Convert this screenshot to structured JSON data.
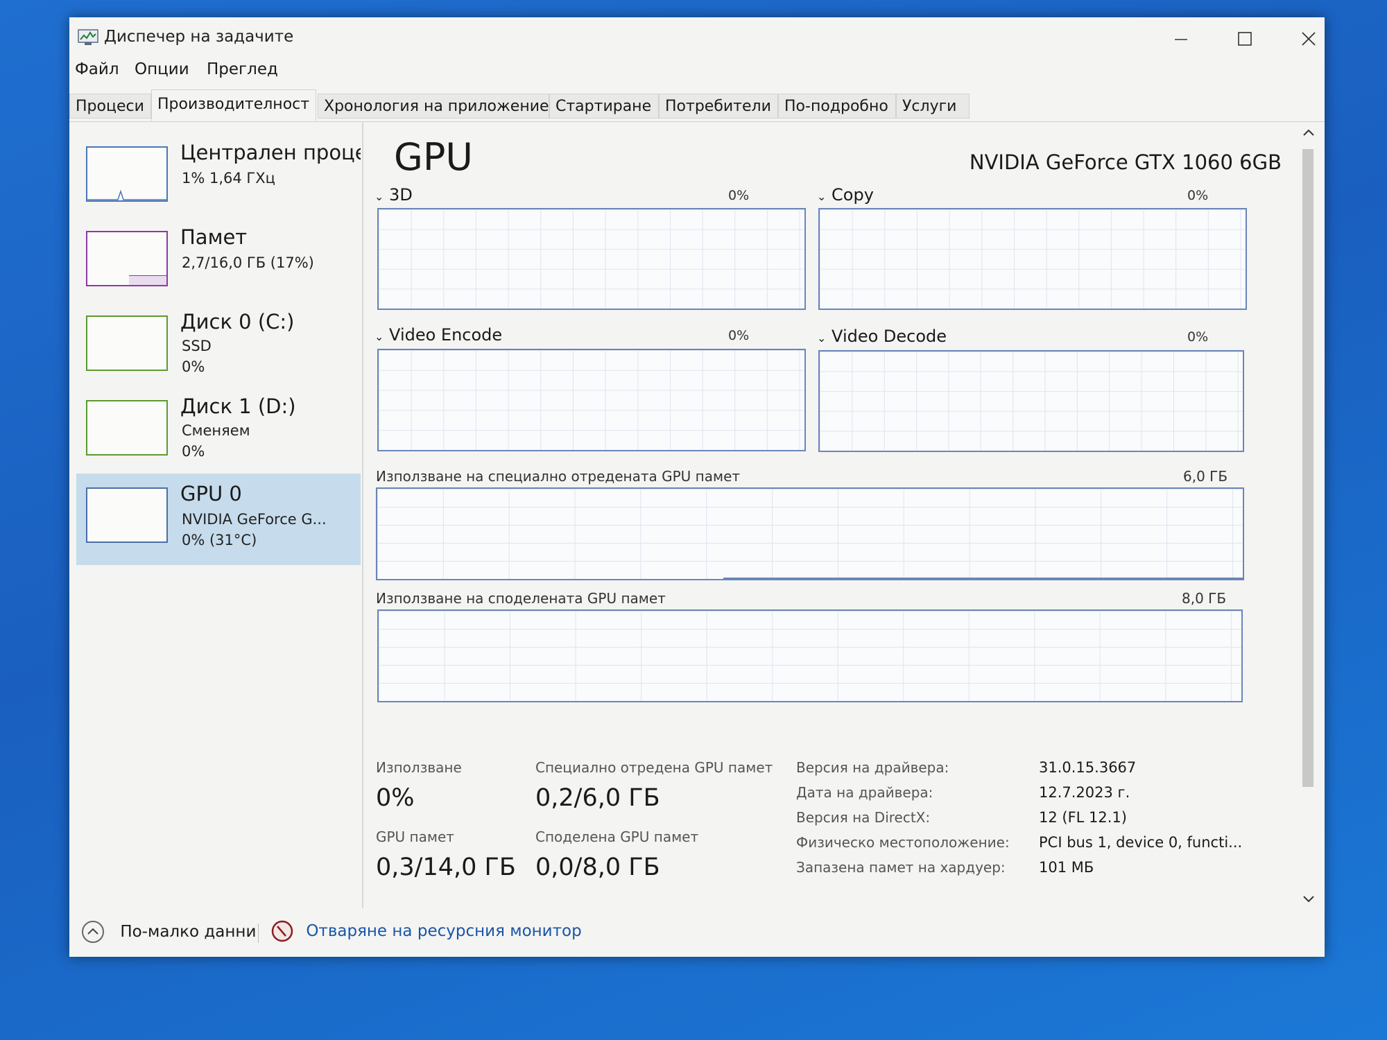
{
  "window": {
    "title": "Диспечер на задачите"
  },
  "menu": [
    "Файл",
    "Опции",
    "Преглед"
  ],
  "tabs": [
    "Процеси",
    "Производителност",
    "Хронология на приложение",
    "Стартиране",
    "Потребители",
    "По-подробно",
    "Услуги"
  ],
  "active_tab": "Производителност",
  "sidebar": {
    "items": [
      {
        "title": "Централен процесор",
        "sub1": "1% 1,64 ГХц",
        "sub2": ""
      },
      {
        "title": "Памет",
        "sub1": "2,7/16,0 ГБ (17%)",
        "sub2": ""
      },
      {
        "title": "Диск 0 (C:)",
        "sub1": "SSD",
        "sub2": "0%"
      },
      {
        "title": "Диск 1 (D:)",
        "sub1": "Сменяем",
        "sub2": "0%"
      },
      {
        "title": "GPU 0",
        "sub1": "NVIDIA GeForce G...",
        "sub2": "0% (31°C)"
      }
    ],
    "selected": "GPU 0",
    "cpu_usage_percent": 1,
    "memory_usage_percent": 17
  },
  "main": {
    "title": "GPU",
    "model": "NVIDIA GeForce GTX 1060 6GB",
    "engines": [
      {
        "name": "3D",
        "percent": "0%"
      },
      {
        "name": "Copy",
        "percent": "0%"
      },
      {
        "name": "Video Encode",
        "percent": "0%"
      },
      {
        "name": "Video Decode",
        "percent": "0%"
      }
    ],
    "dedicated_memory": {
      "label": "Използване на специално отредената GPU памет",
      "max": "6,0 ГБ"
    },
    "shared_memory": {
      "label": "Използване на споделената GPU памет",
      "max": "8,0 ГБ"
    },
    "stats": {
      "usage_label": "Използване",
      "usage_value": "0%",
      "dedicated_label": "Специално отредена GPU памет",
      "dedicated_value": "0,2/6,0 ГБ",
      "gpu_memory_label": "GPU памет",
      "gpu_memory_value": "0,3/14,0 ГБ",
      "shared_label": "Споделена GPU памет",
      "shared_value": "0,0/8,0 ГБ"
    },
    "info": [
      {
        "label": "Версия на драйвера:",
        "value": "31.0.15.3667"
      },
      {
        "label": "Дата на драйвера:",
        "value": "12.7.2023 г."
      },
      {
        "label": "Версия на DirectX:",
        "value": "12 (FL 12.1)"
      },
      {
        "label": "Физическо местоположение:",
        "value": "PCI bus 1, device 0, functi..."
      },
      {
        "label": "Запазена памет на хардуер:",
        "value": "101 МБ"
      }
    ]
  },
  "footer": {
    "fewer_details": "По-малко данни",
    "resource_monitor": "Отваряне на ресурсния монитор"
  },
  "colors": {
    "selection": "#c6dcec",
    "graph_border": "#6a85b8",
    "link": "#1a55a8",
    "cpu_thumb": "#4a78b8",
    "memory_thumb": "#8b3aa4",
    "disk_thumb": "#5c9a2e"
  }
}
